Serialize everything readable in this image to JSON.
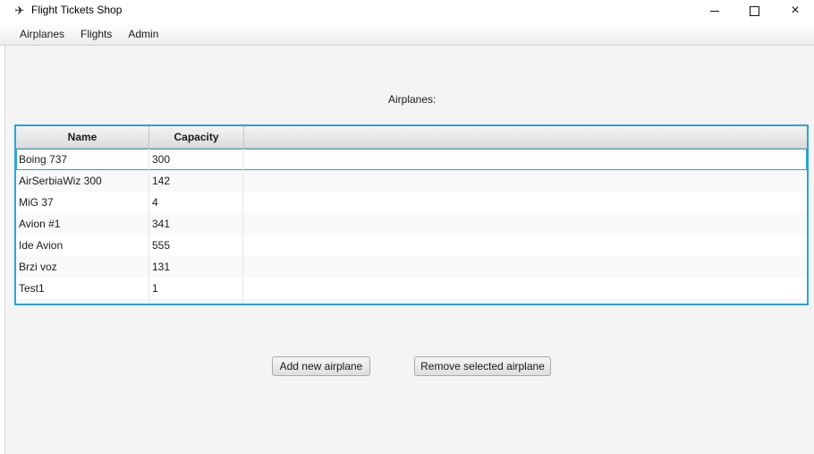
{
  "window": {
    "title": "Flight Tickets Shop",
    "icon": "airplane-icon",
    "controls": {
      "minimize": "minimize-icon",
      "maximize": "maximize-icon",
      "close": "×"
    }
  },
  "menu": {
    "items": [
      "Airplanes",
      "Flights",
      "Admin"
    ]
  },
  "section_label": "Airplanes:",
  "table": {
    "columns": [
      "Name",
      "Capacity"
    ],
    "rows": [
      {
        "name": "Boing 737",
        "capacity": "300"
      },
      {
        "name": "AirSerbiaWiz 300",
        "capacity": "142"
      },
      {
        "name": "MiG 37",
        "capacity": "4"
      },
      {
        "name": "Avion #1",
        "capacity": "341"
      },
      {
        "name": "Ide Avion",
        "capacity": "555"
      },
      {
        "name": "Brzi voz",
        "capacity": "131"
      },
      {
        "name": "Test1",
        "capacity": "1"
      }
    ],
    "selected_row": 0
  },
  "buttons": {
    "add": "Add new airplane",
    "remove": "Remove selected airplane"
  },
  "colors": {
    "accent": "#29a3d6",
    "background": "#f4f4f4"
  }
}
